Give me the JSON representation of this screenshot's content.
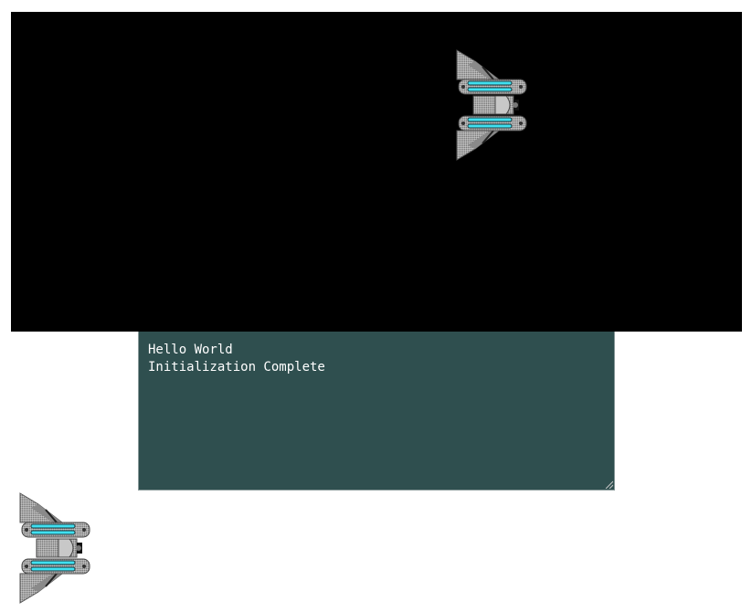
{
  "console": {
    "lines": [
      "Hello World",
      "Initialization Complete"
    ]
  },
  "sprites": {
    "ship": "spaceship-icon",
    "preview": "spaceship-icon"
  },
  "colors": {
    "canvas_background": "#000000",
    "console_background": "#2f4f4f",
    "console_text": "#ffffff",
    "ship_hull": "#a8a8a8",
    "ship_glow": "#40e0f0"
  }
}
